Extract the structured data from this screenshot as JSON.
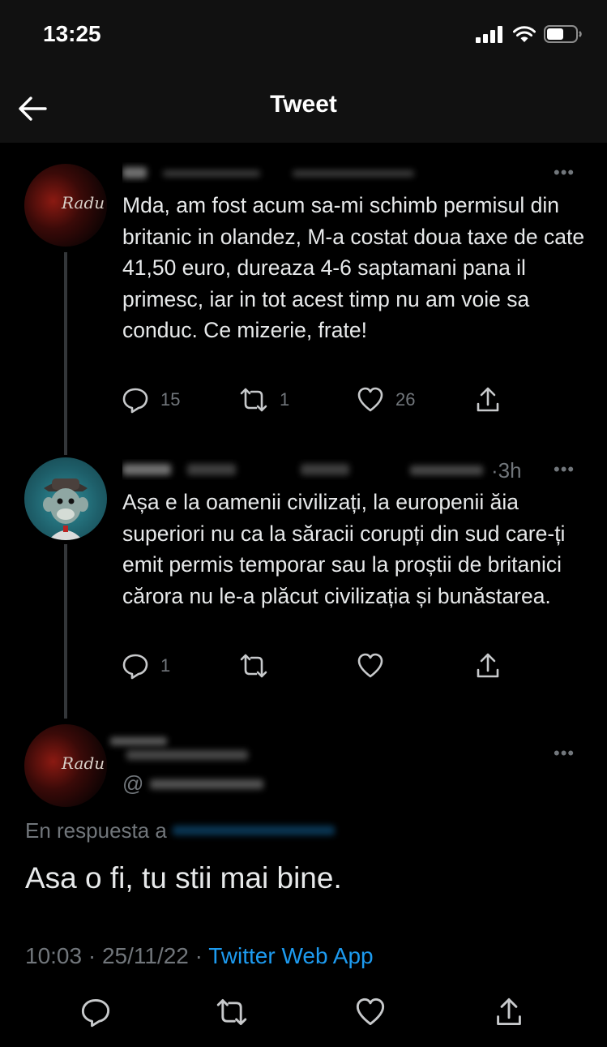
{
  "status_bar": {
    "time": "13:25"
  },
  "header": {
    "title": "Tweet",
    "back_icon": "arrow-left-icon"
  },
  "tweets": [
    {
      "avatar_text": "Radu",
      "body": "Mda, am fost acum sa-mi schimb permisul din britanic in olandez, M-a costat doua taxe de cate 41,50 euro, dureaza 4-6 saptamani pana il primesc,  iar in tot acest timp nu am voie sa conduc. Ce mizerie, frate!",
      "replies": "15",
      "retweets": "1",
      "likes": "26"
    },
    {
      "name_suffix": "·3h",
      "body": "Așa e la oamenii civilizați, la europenii ăia superiori nu ca la săracii corupți din sud care-ți emit permis temporar sau la proștii de britanici cărora nu le-a plăcut civilizația și bunăstarea.",
      "replies": "1",
      "retweets": "",
      "likes": ""
    }
  ],
  "main_tweet": {
    "avatar_text": "Radu",
    "handle_prefix": "@",
    "reply_to_label": "En respuesta a",
    "text": "Asa o fi, tu stii mai bine.",
    "time": "10:03 · 25/11/22 · ",
    "source": "Twitter Web App"
  },
  "colors": {
    "background": "#000000",
    "text": "#e7e9ea",
    "muted": "#71767b",
    "link": "#1d9bf0",
    "bar": "#111111"
  }
}
